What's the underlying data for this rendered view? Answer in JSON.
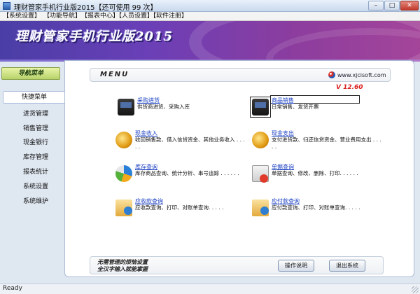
{
  "window": {
    "title": "理财管家手机行业版2015【还可使用 99 次】",
    "min": "–",
    "max": "□",
    "close": "✕"
  },
  "menubar": [
    "【系统设置】",
    "【功能导航】",
    "【报表中心】",
    "【人员设置】",
    "【软件注册】"
  ],
  "banner": {
    "title": "理财管家手机行业版2015"
  },
  "sidebar": {
    "header": "导航菜单",
    "items": [
      "快捷菜单",
      "进货管理",
      "销售管理",
      "现金银行",
      "库存管理",
      "报表统计",
      "系统设置",
      "系统维护"
    ],
    "active_index": 0
  },
  "main": {
    "menu_title": "MENU",
    "brand": "www.xjcisoft.com",
    "version": "V 12.60",
    "modules": [
      {
        "title": "采购进货",
        "desc": "供货商进货、采购入库",
        "icon": "cash-register-icon"
      },
      {
        "title": "商品销售",
        "desc": "日常销售、发货开票",
        "icon": "cash-register-icon"
      },
      {
        "title": "现金收入",
        "desc": "收回销售款、借入信贷资金、其他业务收入 . . . . .",
        "icon": "coins-icon"
      },
      {
        "title": "现金支出",
        "desc": "支付进货款、归还信贷资金、营业费用支出 . . . . .",
        "icon": "coins-icon"
      },
      {
        "title": "库存查询",
        "desc": "库存商品查询、统计分析、串号追踪 . . . . . .",
        "icon": "pie-chart-icon"
      },
      {
        "title": "单据查询",
        "desc": "单据查询、修改、删除、打印. . . . . .",
        "icon": "documents-icon"
      },
      {
        "title": "应收款查询",
        "desc": "应收款查询、打印、对账单查询. . . . .",
        "icon": "folder-icon"
      },
      {
        "title": "应付款查询",
        "desc": "应付款查询、打印、对账单查询. . . . .",
        "icon": "folder-icon"
      }
    ]
  },
  "footer": {
    "note_line1": "无需管理的烦恼设置",
    "note_line2": "全汉字输入就能掌握",
    "help_button": "操作说明",
    "exit_button": "退出系统"
  },
  "statusbar": {
    "text": "Ready"
  }
}
